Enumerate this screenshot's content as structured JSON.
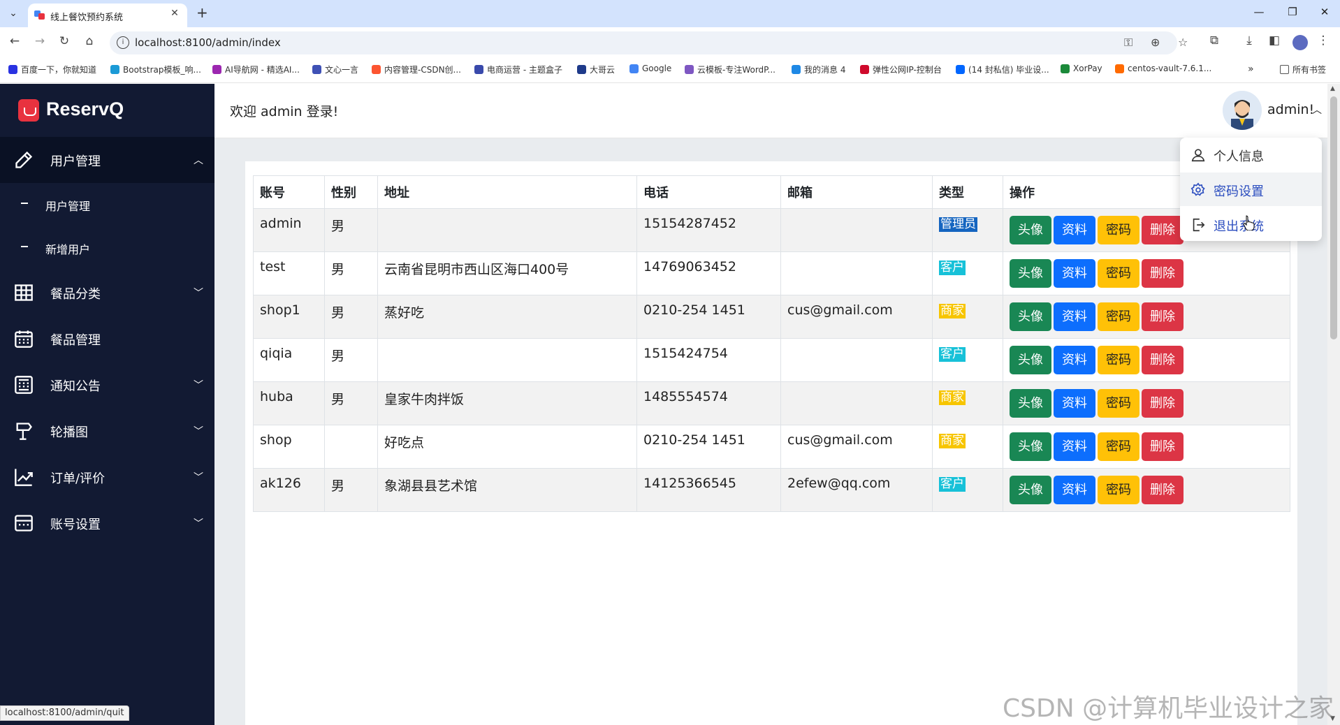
{
  "browser": {
    "tab_title": "线上餐饮预约系统",
    "url": "localhost:8100/admin/index",
    "bookmarks": [
      {
        "label": "百度一下，你就知道",
        "color": "#2932e1"
      },
      {
        "label": "Bootstrap模板_响...",
        "color": "#1b9ad6"
      },
      {
        "label": "AI导航网 - 精选AI...",
        "color": "#9c27b0"
      },
      {
        "label": "文心一言",
        "color": "#3f51b5"
      },
      {
        "label": "内容管理-CSDN创...",
        "color": "#fc5531"
      },
      {
        "label": "电商运营 - 主题盒子",
        "color": "#3949ab"
      },
      {
        "label": "大哥云",
        "color": "#1e3a8a"
      },
      {
        "label": "Google",
        "color": "#4285f4"
      },
      {
        "label": "云模板-专注WordP...",
        "color": "#7e57c2"
      },
      {
        "label": "我的消息 4",
        "color": "#1e88e5"
      },
      {
        "label": "弹性公网IP-控制台",
        "color": "#cf0a2c"
      },
      {
        "label": "(14 封私信) 毕业设...",
        "color": "#0066ff"
      },
      {
        "label": "XorPay",
        "color": "#1b8a3a"
      },
      {
        "label": "centos-vault-7.6.1...",
        "color": "#ff6a00"
      }
    ],
    "all_bookmarks": "所有书签",
    "status_url": "localhost:8100/admin/quit"
  },
  "brand": {
    "name": "ReservQ"
  },
  "sidebar": {
    "groups": [
      {
        "label": "用户管理",
        "icon": "pencil-icon",
        "caret": "⌃"
      },
      {
        "label": "餐品分类",
        "icon": "grid-icon",
        "caret": "⌄"
      },
      {
        "label": "餐品管理",
        "icon": "calendar-icon",
        "caret": ""
      },
      {
        "label": "通知公告",
        "icon": "keyboard-icon",
        "caret": "⌄"
      },
      {
        "label": "轮播图",
        "icon": "sign-icon",
        "caret": "⌄"
      },
      {
        "label": "订单/评价",
        "icon": "chart-icon",
        "caret": "⌄"
      },
      {
        "label": "账号设置",
        "icon": "id-card-icon",
        "caret": "⌄"
      }
    ],
    "sub_items": [
      {
        "label": "用户管理"
      },
      {
        "label": "新增用户"
      }
    ]
  },
  "header": {
    "welcome": "欢迎 admin 登录!",
    "user_name": "admin!"
  },
  "dropdown": {
    "items": [
      {
        "label": "个人信息",
        "icon": "user-icon"
      },
      {
        "label": "密码设置",
        "icon": "gear-icon"
      },
      {
        "label": "退出系统",
        "icon": "logout-icon"
      }
    ]
  },
  "table": {
    "columns": [
      "账号",
      "性别",
      "地址",
      "电话",
      "邮箱",
      "类型",
      "操作"
    ],
    "rows": [
      {
        "account": "admin",
        "gender": "男",
        "address": "",
        "phone": "15154287452",
        "email": "",
        "type": "管理员",
        "type_kind": "admin"
      },
      {
        "account": "test",
        "gender": "男",
        "address": "云南省昆明市西山区海口400号",
        "phone": "14769063452",
        "email": "",
        "type": "客户",
        "type_kind": "cust"
      },
      {
        "account": "shop1",
        "gender": "男",
        "address": "蒸好吃",
        "phone": "0210-254 1451",
        "email": "cus@gmail.com",
        "type": "商家",
        "type_kind": "shop"
      },
      {
        "account": "qiqia",
        "gender": "男",
        "address": "",
        "phone": "1515424754",
        "email": "",
        "type": "客户",
        "type_kind": "cust"
      },
      {
        "account": "huba",
        "gender": "男",
        "address": "皇家牛肉拌饭",
        "phone": "1485554574",
        "email": "",
        "type": "商家",
        "type_kind": "shop"
      },
      {
        "account": "shop",
        "gender": "",
        "address": "好吃点",
        "phone": "0210-254 1451",
        "email": "cus@gmail.com",
        "type": "商家",
        "type_kind": "shop"
      },
      {
        "account": "ak126",
        "gender": "男",
        "address": "象湖县县艺术馆",
        "phone": "14125366545",
        "email": "2efew@qq.com",
        "type": "客户",
        "type_kind": "cust"
      }
    ],
    "actions": {
      "avatar": "头像",
      "info": "资料",
      "password": "密码",
      "delete": "删除"
    }
  },
  "watermark": "CSDN @计算机毕业设计之家"
}
